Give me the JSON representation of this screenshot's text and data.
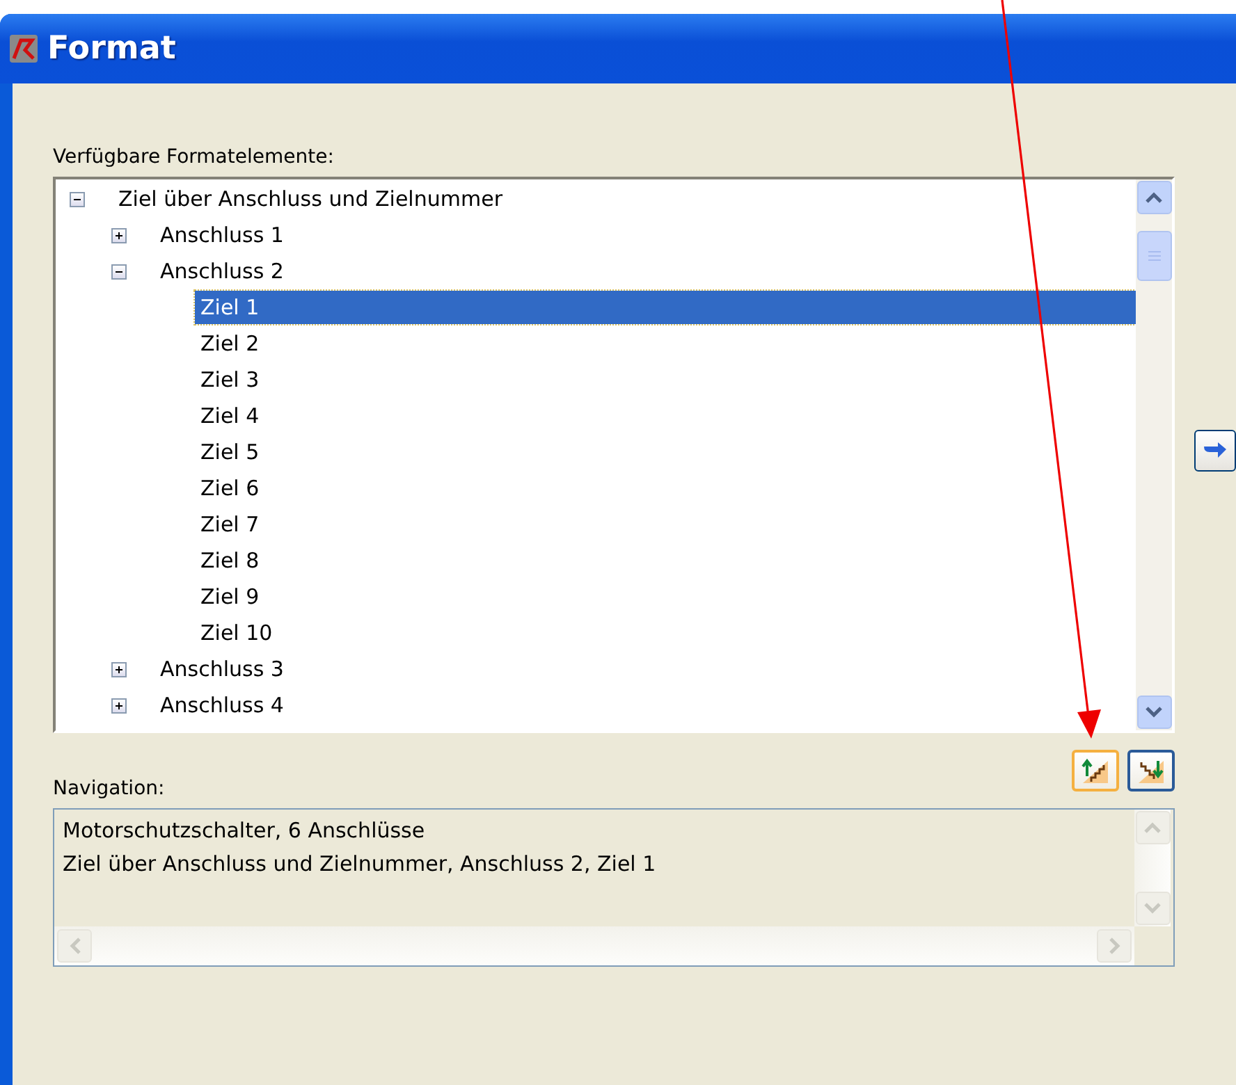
{
  "window": {
    "title": "Format"
  },
  "tree_label": "Verfügbare Formatelemente:",
  "tree": [
    {
      "label": "Ziel über Anschluss und Zielnummer",
      "expanded": true,
      "selected": false,
      "children": [
        {
          "label": "Anschluss 1",
          "expanded": false,
          "selected": false
        },
        {
          "label": "Anschluss 2",
          "expanded": true,
          "selected": false,
          "children": [
            {
              "label": "Ziel 1",
              "selected": true
            },
            {
              "label": "Ziel 2",
              "selected": false
            },
            {
              "label": "Ziel 3",
              "selected": false
            },
            {
              "label": "Ziel 4",
              "selected": false
            },
            {
              "label": "Ziel 5",
              "selected": false
            },
            {
              "label": "Ziel 6",
              "selected": false
            },
            {
              "label": "Ziel 7",
              "selected": false
            },
            {
              "label": "Ziel 8",
              "selected": false
            },
            {
              "label": "Ziel 9",
              "selected": false
            },
            {
              "label": "Ziel 10",
              "selected": false
            }
          ]
        },
        {
          "label": "Anschluss 3",
          "expanded": false,
          "selected": false
        },
        {
          "label": "Anschluss 4",
          "expanded": false,
          "selected": false
        }
      ]
    }
  ],
  "navigation_label": "Navigation:",
  "navigation_lines": [
    "Motorschutzschalter, 6 Anschlüsse",
    "Ziel über Anschluss und Zielnummer, Anschluss 2, Ziel 1"
  ],
  "nav_buttons": [
    {
      "kind": "up",
      "hovered": true
    },
    {
      "kind": "down",
      "hovered": false
    }
  ]
}
